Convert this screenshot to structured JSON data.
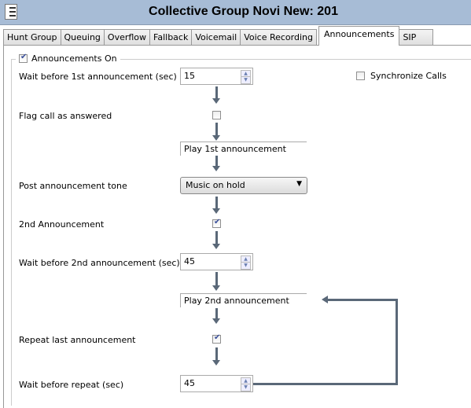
{
  "window": {
    "title": "Collective Group Novi New: 201",
    "icon": "list-icon"
  },
  "tabs": [
    "Hunt Group",
    "Queuing",
    "Overflow",
    "Fallback",
    "Voicemail",
    "Voice Recording",
    "Announcements",
    "SIP"
  ],
  "active_tab": "Announcements",
  "form": {
    "announcements_on": {
      "label": "Announcements On",
      "checked": true
    },
    "synchronize_calls": {
      "label": "Synchronize Calls",
      "checked": false
    },
    "wait1": {
      "label": "Wait before 1st announcement (sec)",
      "value": "15"
    },
    "flag_answered": {
      "label": "Flag call as answered",
      "checked": false
    },
    "play1": "Play 1st announcement",
    "post_tone": {
      "label": "Post announcement tone",
      "value": "Music on hold"
    },
    "second": {
      "label": "2nd Announcement",
      "checked": true
    },
    "wait2": {
      "label": "Wait before 2nd announcement (sec)",
      "value": "45"
    },
    "play2": "Play 2nd announcement",
    "repeat_last": {
      "label": "Repeat last announcement",
      "checked": true
    },
    "wait_repeat": {
      "label": "Wait before repeat (sec)",
      "value": "45"
    }
  },
  "colors": {
    "titlebar": "#a7bcd6",
    "flow_arrow": "#5a6878"
  }
}
